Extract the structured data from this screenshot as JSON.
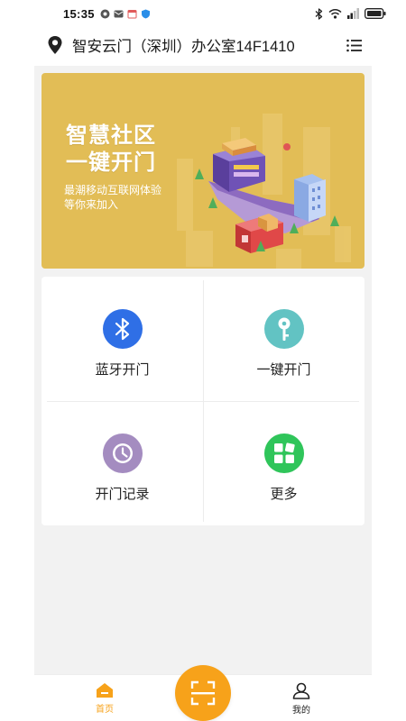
{
  "status_bar": {
    "time": "15:35",
    "notification_icons": [
      "settings-icon",
      "mail-icon",
      "calendar-icon",
      "shield-icon"
    ],
    "right_icons": [
      "bluetooth-icon",
      "wifi-icon",
      "signal-icon",
      "battery-icon"
    ]
  },
  "header": {
    "title": "智安云门（深圳）办公室14F1410",
    "location_icon": "location-pin-icon",
    "menu_icon": "list-menu-icon"
  },
  "banner": {
    "title_line1": "智慧社区",
    "title_line2": "一键开门",
    "subtitle_line1": "最潮移动互联网体验",
    "subtitle_line2": "等你来加入",
    "background_color": "#e2bd56"
  },
  "grid": {
    "items": [
      {
        "label": "蓝牙开门",
        "icon": "bluetooth-icon",
        "color": "#2f6fe6"
      },
      {
        "label": "一键开门",
        "icon": "key-icon",
        "color": "#62c3c3"
      },
      {
        "label": "开门记录",
        "icon": "clock-icon",
        "color": "#a48cc0"
      },
      {
        "label": "更多",
        "icon": "more-grid-icon",
        "color": "#2fc55a"
      }
    ]
  },
  "bottom_nav": {
    "home_label": "首页",
    "mine_label": "我的",
    "active_color": "#f7a21a",
    "scan_color": "#f7a21a"
  }
}
